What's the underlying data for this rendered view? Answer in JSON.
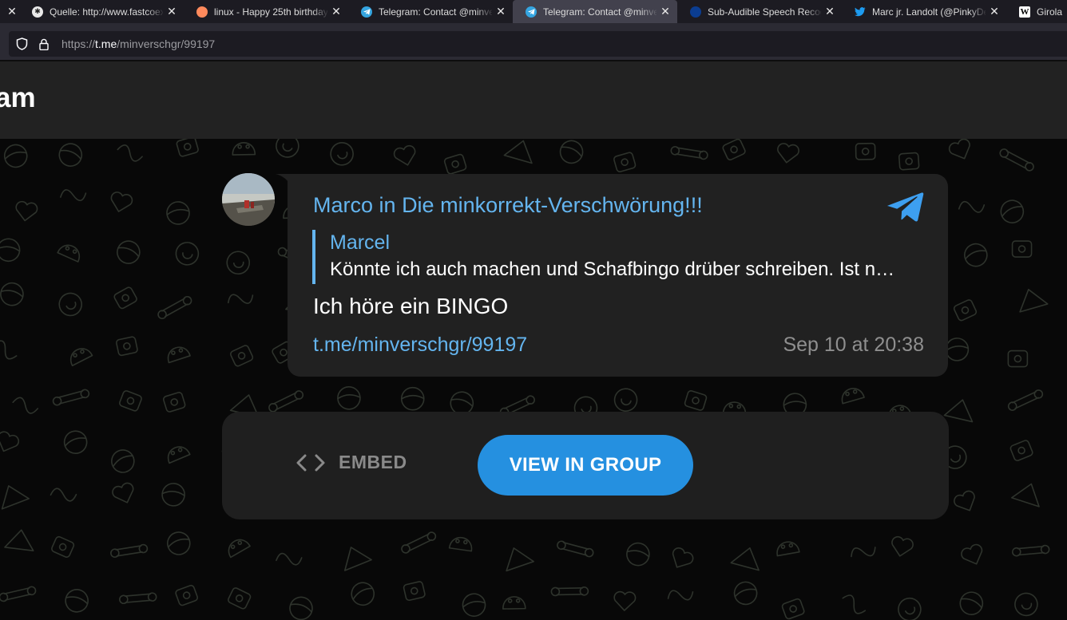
{
  "browser": {
    "tabs": [
      {
        "title": "",
        "icon": "tab-icon",
        "active": false
      },
      {
        "title": "Quelle: http://www.fastcoex",
        "icon": "asterisk-icon",
        "active": false
      },
      {
        "title": "linux - Happy 25th birthday",
        "icon": "speech-bubble-icon",
        "active": false
      },
      {
        "title": "Telegram: Contact @minver",
        "icon": "telegram-icon",
        "active": false
      },
      {
        "title": "Telegram: Contact @minver",
        "icon": "telegram-icon",
        "active": true
      },
      {
        "title": "Sub-Audible Speech Recogn",
        "icon": "nasa-icon",
        "active": false
      },
      {
        "title": "Marc jr. Landolt (@PinkyDe",
        "icon": "twitter-bird-icon",
        "active": false
      },
      {
        "title": "Girolam",
        "icon": "wikipedia-icon",
        "active": false
      }
    ],
    "url": {
      "scheme": "https://",
      "host": "t.me",
      "path": "/minverschgr/99197"
    }
  },
  "page": {
    "brand": "am"
  },
  "message": {
    "author": "Marco",
    "in_word": "in",
    "group": "Die minkorrekt-Verschwörung!!!",
    "reply": {
      "name": "Marcel",
      "text": "Könnte ich auch machen und Schafbingo drüber schreiben. Ist n…"
    },
    "text": "Ich höre ein BINGO",
    "link": "t.me/minverschgr/99197",
    "date": "Sep 10 at 20:38"
  },
  "actions": {
    "embed_label": "EMBED",
    "view_label": "VIEW IN GROUP"
  },
  "colors": {
    "accent": "#64b5ef",
    "button": "#2590e0",
    "bubble": "#212121"
  }
}
